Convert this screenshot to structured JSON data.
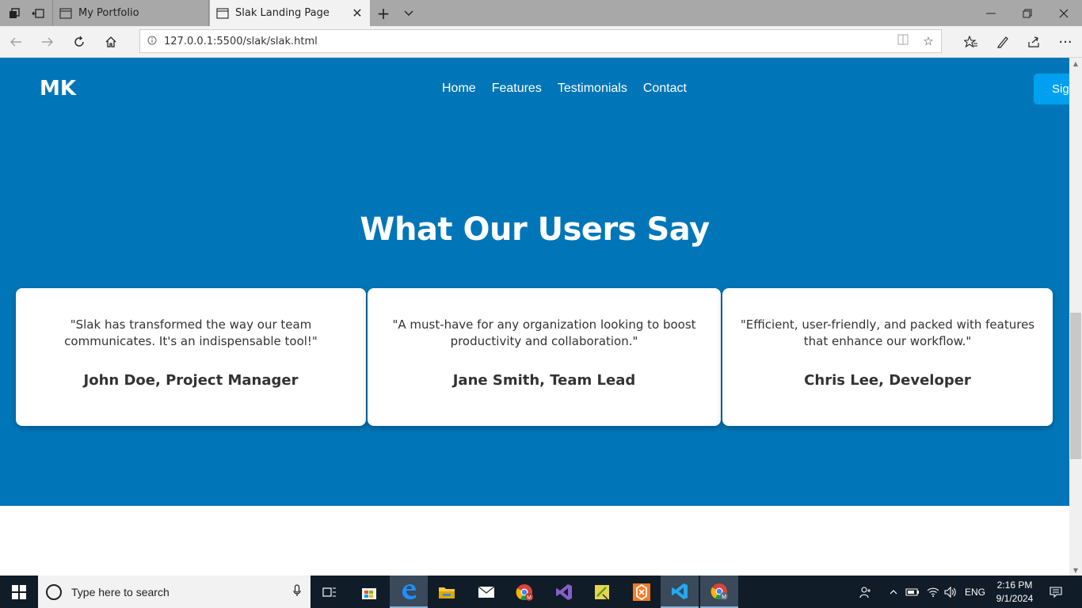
{
  "browser": {
    "tabs": [
      {
        "title": "My Portfolio",
        "active": false
      },
      {
        "title": "Slak Landing Page",
        "active": true
      }
    ],
    "url": "127.0.0.1:5500/slak/slak.html"
  },
  "site": {
    "logo": "MK",
    "nav": [
      "Home",
      "Features",
      "Testimonials",
      "Contact"
    ],
    "signup_label": "Sign",
    "colors": {
      "header_bg": "#0076b8",
      "button_bg": "#00a0f0",
      "card_bg": "#ffffff"
    }
  },
  "testimonials": {
    "title": "What Our Users Say",
    "items": [
      {
        "quote": "\"Slak has transformed the way our team communicates. It's an indispensable tool!\"",
        "author": "John Doe, Project Manager"
      },
      {
        "quote": "\"A must-have for any organization looking to boost productivity and collaboration.\"",
        "author": "Jane Smith, Team Lead"
      },
      {
        "quote": "\"Efficient, user-friendly, and packed with features that enhance our workflow.\"",
        "author": "Chris Lee, Developer"
      }
    ]
  },
  "taskbar": {
    "search_placeholder": "Type here to search",
    "language": "ENG",
    "time": "2:16 PM",
    "date": "9/1/2024"
  }
}
